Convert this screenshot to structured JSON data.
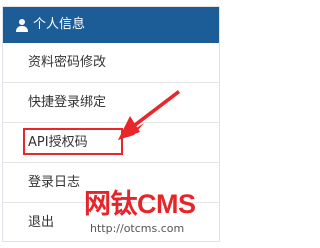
{
  "panel": {
    "title": "个人信息",
    "title_icon": "user-icon",
    "header_color": "#1c5c97"
  },
  "menu": {
    "items": [
      {
        "label": "资料密码修改"
      },
      {
        "label": "快捷登录绑定"
      },
      {
        "label": "API授权码",
        "highlighted": true
      },
      {
        "label": "登录日志"
      },
      {
        "label": "退出"
      }
    ]
  },
  "annotation": {
    "highlight_color": "#e8262c",
    "arrow_icon": "red-arrow-icon"
  },
  "watermark": {
    "brand": "网钛CMS",
    "url": "http://otcms.com"
  }
}
